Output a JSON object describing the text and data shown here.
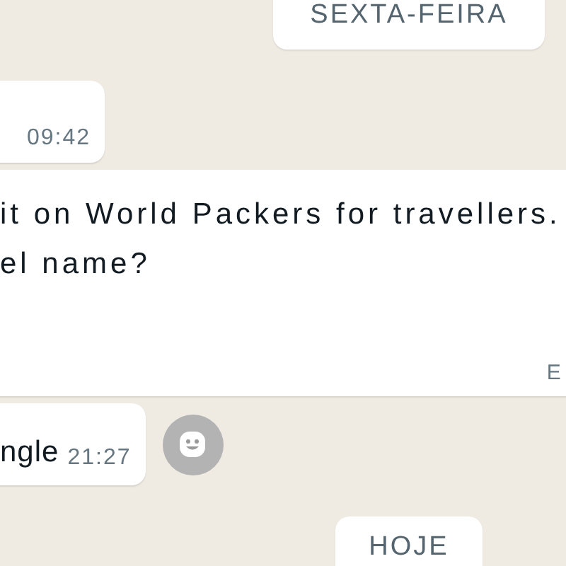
{
  "messages": [
    {
      "kind": "date",
      "text": "SEXTA-FEIRA"
    },
    {
      "kind": "incoming",
      "time": "09:42"
    },
    {
      "kind": "incoming",
      "text": "it on World Packers for travellers.\nel name?",
      "edge_text": "E"
    },
    {
      "kind": "incoming",
      "text": "ngle",
      "time": "21:27",
      "reaction_button": true
    },
    {
      "kind": "date",
      "text": "HOJE"
    }
  ]
}
